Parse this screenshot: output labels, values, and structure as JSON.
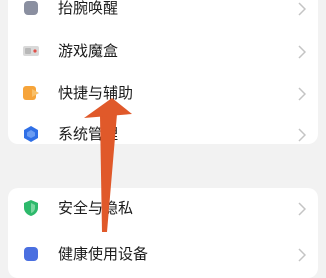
{
  "settings": {
    "items": [
      {
        "label": "抬腕唤醒",
        "icon": "gesture-icon",
        "color": "#8a8fa0"
      },
      {
        "label": "游戏魔盒",
        "icon": "game-box-icon",
        "color": "#c8c8c8"
      },
      {
        "label": "快捷与辅助",
        "icon": "shortcut-icon",
        "color": "#f6a43a"
      },
      {
        "label": "系统管理",
        "icon": "system-manage-icon",
        "color": "#2f6fe6"
      },
      {
        "label": "安全与隐私",
        "icon": "security-shield-icon",
        "color": "#2db96b"
      },
      {
        "label": "健康使用设备",
        "icon": "health-usage-icon",
        "color": "#4a6fe0"
      }
    ]
  },
  "annotation": {
    "arrow_color": "#e0592a",
    "target": "快捷与辅助"
  }
}
